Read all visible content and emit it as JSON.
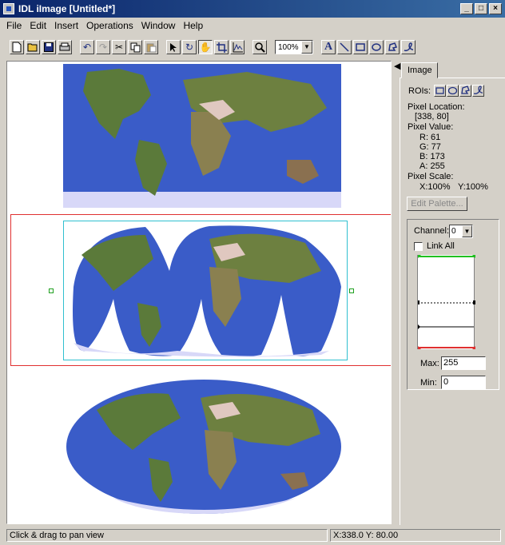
{
  "window": {
    "title": "IDL iImage [Untitled*]",
    "minimize": "_",
    "maximize": "□",
    "close": "×"
  },
  "menu": [
    "File",
    "Edit",
    "Insert",
    "Operations",
    "Window",
    "Help"
  ],
  "toolbar": {
    "zoom": "100%"
  },
  "panel": {
    "tab": "Image",
    "rois_label": "ROIs:",
    "pixel_location_label": "Pixel Location:",
    "pixel_location": "[338, 80]",
    "pixel_value_label": "Pixel Value:",
    "r": "R: 61",
    "g": "G: 77",
    "b": "B: 173",
    "a": "A: 255",
    "pixel_scale_label": "Pixel Scale:",
    "x_scale": "X:100%",
    "y_scale": "Y:100%",
    "edit_palette": "Edit Palette...",
    "channel_label": "Channel:",
    "channel_value": "0",
    "link_all": "Link All",
    "max_label": "Max:",
    "max_value": "255",
    "min_label": "Min:",
    "min_value": "0"
  },
  "status": {
    "hint": "Click & drag to pan view",
    "coords": "X:338.0  Y: 80.00"
  },
  "colors": {
    "ocean": "#3a5cc8",
    "land": "#5b7a3a",
    "ice": "#d8d8f8",
    "selection": "#e03030",
    "bbox": "#30c0d0",
    "handle": "#20a020"
  }
}
